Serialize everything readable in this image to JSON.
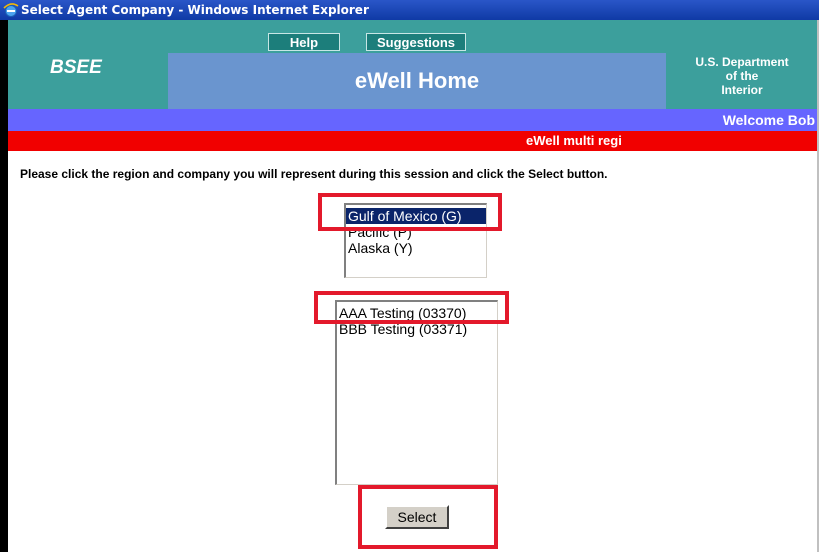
{
  "window": {
    "title": "Select Agent Company - Windows Internet Explorer",
    "icon": "ie-icon"
  },
  "nav": {
    "help_label": "Help",
    "suggestions_label": "Suggestions"
  },
  "header": {
    "logo": "BSEE",
    "title": "eWell Home",
    "dept_line1": "U.S. Department",
    "dept_line2": "of the",
    "dept_line3": "Interior"
  },
  "welcome": "Welcome Bob",
  "banner": "eWell multi regi",
  "instruction": "Please click the region and company you will represent during this session and click the Select button.",
  "regions": [
    "Gulf of Mexico (G)",
    "Pacific (P)",
    "Alaska (Y)"
  ],
  "selected_region": "Gulf of Mexico (G)",
  "companies": [
    "AAA Testing (03370)",
    "BBB Testing (03371)"
  ],
  "select_button": "Select",
  "colors": {
    "teal": "#3c9f9c",
    "hero_blue": "#6a95cf",
    "welcome_bar": "#6665ff",
    "red_bar": "#f10000",
    "highlight": "#e3192b",
    "selection": "#0a246a"
  }
}
